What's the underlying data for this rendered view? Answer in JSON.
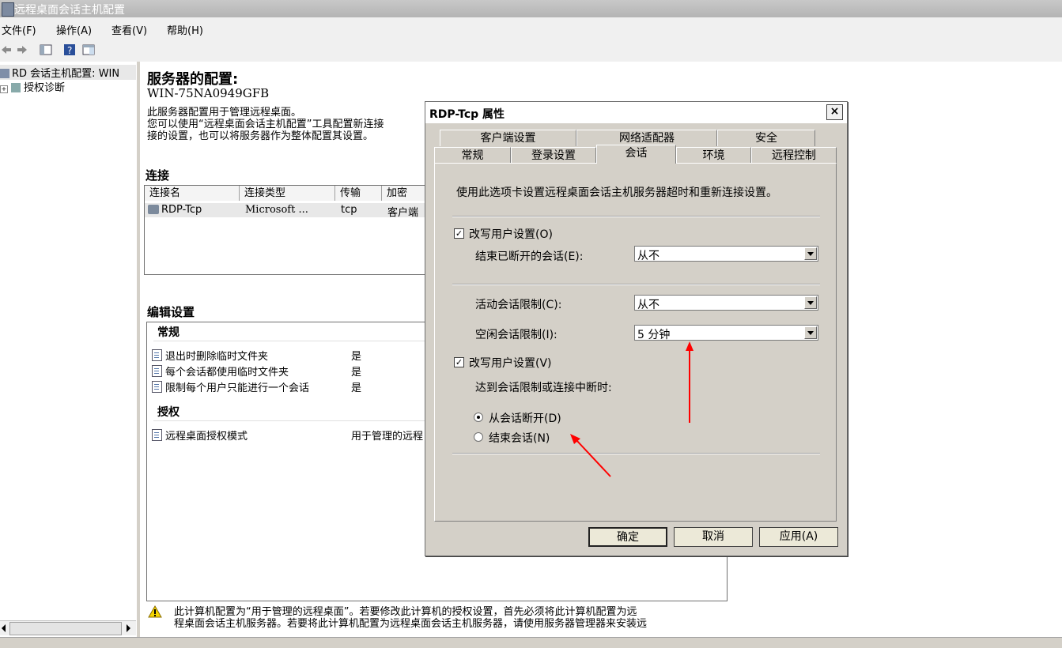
{
  "window": {
    "title": "远程桌面会话主机配置"
  },
  "menu": [
    "文件(F)",
    "操作(A)",
    "查看(V)",
    "帮助(H)"
  ],
  "tree": {
    "root": "RD 会话主机配置: WIN",
    "child": "授权诊断"
  },
  "main": {
    "heading": "服务器的配置:",
    "server_name": "WIN-75NA0949GFB",
    "desc_line1": "此服务器配置用于管理远程桌面。",
    "desc_line2": "您可以使用“远程桌面会话主机配置”工具配置新连接",
    "desc_line3": "接的设置，也可以将服务器作为整体配置其设置。",
    "connections_heading": "连接",
    "columns": [
      "连接名",
      "连接类型",
      "传输",
      "加密"
    ],
    "row": {
      "name": "RDP-Tcp",
      "type": "Microsoft ...",
      "transport": "tcp",
      "encryption": "客户端"
    },
    "edit_heading": "编辑设置",
    "general_heading": "常规",
    "general_items": [
      {
        "label": "退出时删除临时文件夹",
        "value": "是"
      },
      {
        "label": "每个会话都使用临时文件夹",
        "value": "是"
      },
      {
        "label": "限制每个用户只能进行一个会话",
        "value": "是"
      }
    ],
    "license_heading": "授权",
    "license_item": {
      "label": "远程桌面授权模式",
      "value": "用于管理的远程"
    },
    "warning_line1": "此计算机配置为“用于管理的远程桌面”。若要修改此计算机的授权设置，首先必须将此计算机配置为远",
    "warning_line2": "程桌面会话主机服务器。若要将此计算机配置为远程桌面会话主机服务器，请使用服务器管理器来安装远"
  },
  "dialog": {
    "title": "RDP-Tcp 属性",
    "close": "×",
    "tabs_top": [
      "客户端设置",
      "网络适配器",
      "安全"
    ],
    "tabs_bottom": [
      "常规",
      "登录设置",
      "会话",
      "环境",
      "远程控制"
    ],
    "intro": "使用此选项卡设置远程桌面会话主机服务器超时和重新连接设置。",
    "override1_label": "改写用户设置(O)",
    "end_disconnected_label": "结束已断开的会话(E):",
    "end_disconnected_value": "从不",
    "active_limit_label": "活动会话限制(C):",
    "active_limit_value": "从不",
    "idle_limit_label": "空闲会话限制(I):",
    "idle_limit_value": "5 分钟",
    "override2_label": "改写用户设置(V)",
    "when_reached_label": "达到会话限制或连接中断时:",
    "radio_disconnect": "从会话断开(D)",
    "radio_end": "结束会话(N)",
    "ok": "确定",
    "cancel": "取消",
    "apply": "应用(A)",
    "check_mark": "✓"
  },
  "colors": {
    "annotation_arrow": "#ff0000",
    "dialog_bg": "#d4d0c8"
  }
}
